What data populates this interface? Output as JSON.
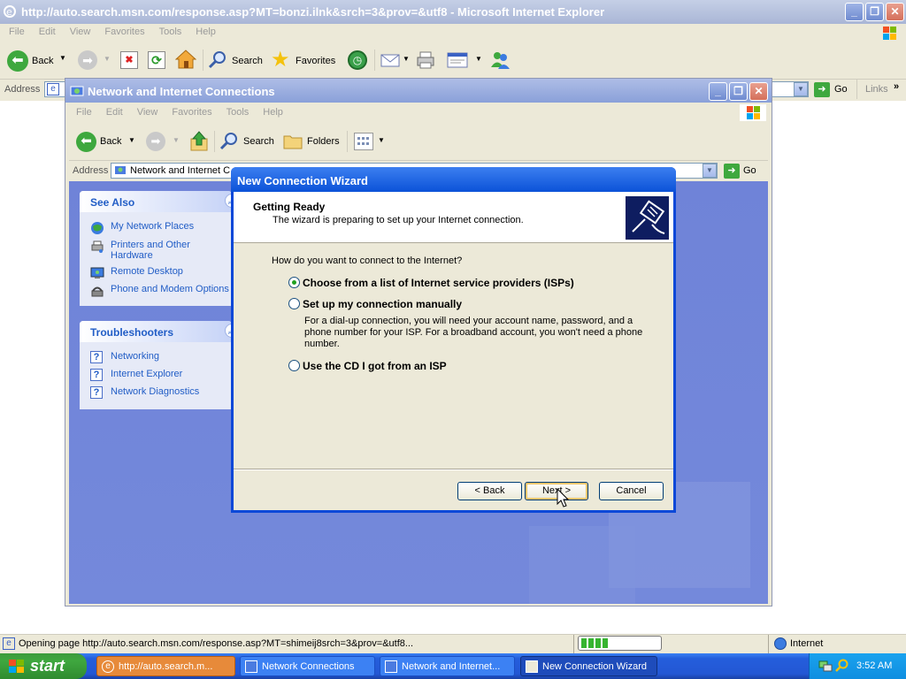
{
  "ie": {
    "title": "http://auto.search.msn.com/response.asp?MT=bonzi.ilnk&srch=3&prov=&utf8 - Microsoft Internet Explorer",
    "menu": [
      "File",
      "Edit",
      "View",
      "Favorites",
      "Tools",
      "Help"
    ],
    "toolbar": {
      "back": "Back",
      "search": "Search",
      "favorites": "Favorites"
    },
    "address_label": "Address",
    "go": "Go",
    "links": "Links"
  },
  "explorer": {
    "title": "Network and Internet Connections",
    "menu": [
      "File",
      "Edit",
      "View",
      "Favorites",
      "Tools",
      "Help"
    ],
    "toolbar": {
      "back": "Back",
      "search": "Search",
      "folders": "Folders"
    },
    "address_label": "Address",
    "address_value": "Network and Internet C",
    "go": "Go",
    "see_also": {
      "header": "See Also",
      "items": [
        "My Network Places",
        "Printers and Other Hardware",
        "Remote Desktop",
        "Phone and Modem Options"
      ]
    },
    "troubleshooters": {
      "header": "Troubleshooters",
      "items": [
        "Networking",
        "Internet Explorer",
        "Network Diagnostics"
      ]
    }
  },
  "wizard": {
    "title": "New Connection Wizard",
    "heading": "Getting Ready",
    "subheading": "The wizard is preparing to set up your Internet connection.",
    "question": "How do you want to connect to the Internet?",
    "options": [
      {
        "label": "Choose from a list of Internet service providers (ISPs)",
        "selected": true
      },
      {
        "label": "Set up my connection manually",
        "selected": false,
        "description": "For a dial-up connection, you will need your account name, password, and a phone number for your ISP. For a broadband account, you won't need a phone number."
      },
      {
        "label": "Use the CD I got from an ISP",
        "selected": false
      }
    ],
    "buttons": {
      "back": "< Back",
      "next": "Next >",
      "cancel": "Cancel"
    }
  },
  "status": {
    "text": "Opening page http://auto.search.msn.com/response.asp?MT=shimeij8srch=3&prov=&utf8...",
    "progress_chunks": 4,
    "zone": "Internet"
  },
  "taskbar": {
    "start": "start",
    "tasks": [
      "http://auto.search.m...",
      "Network Connections",
      "Network and Internet...",
      "New Connection Wizard"
    ],
    "clock": "3:52 AM"
  },
  "colors": {
    "xp_blue": "#0a48d8",
    "task_pane_link": "#215dc6",
    "start_green": "#3fa73f"
  }
}
